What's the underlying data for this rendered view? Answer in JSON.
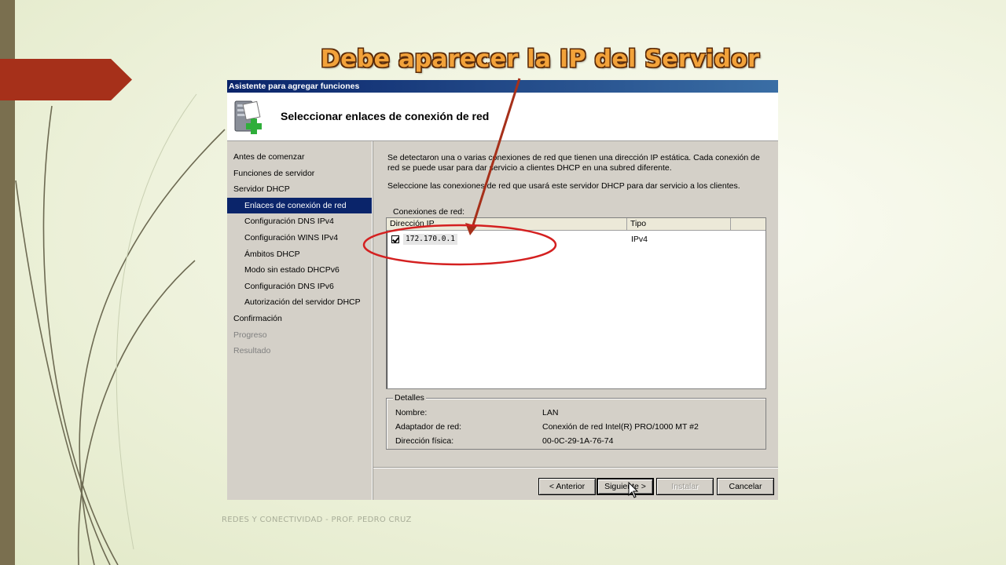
{
  "slide": {
    "title": "Debe aparecer la IP del Servidor",
    "footer": "REDES Y CONECTIVIDAD - PROF. PEDRO CRUZ"
  },
  "dialog": {
    "window_title": "Asistente para agregar funciones",
    "heading": "Seleccionar enlaces de conexión de red",
    "nav_items": [
      {
        "label": "Antes de comenzar",
        "state": "normal"
      },
      {
        "label": "Funciones de servidor",
        "state": "normal"
      },
      {
        "label": "Servidor DHCP",
        "state": "normal"
      },
      {
        "label": "Enlaces de conexión de red",
        "state": "selected"
      },
      {
        "label": "Configuración DNS IPv4",
        "state": "normal"
      },
      {
        "label": "Configuración WINS IPv4",
        "state": "normal"
      },
      {
        "label": "Ámbitos DHCP",
        "state": "normal"
      },
      {
        "label": "Modo sin estado DHCPv6",
        "state": "normal"
      },
      {
        "label": "Configuración DNS IPv6",
        "state": "normal"
      },
      {
        "label": "Autorización del servidor DHCP",
        "state": "normal"
      },
      {
        "label": "Confirmación",
        "state": "normal"
      },
      {
        "label": "Progreso",
        "state": "disabled"
      },
      {
        "label": "Resultado",
        "state": "disabled"
      }
    ],
    "description": "Se detectaron una o varias conexiones de red que tienen una dirección IP estática. Cada conexión de red se puede usar para dar servicio a clientes DHCP en una subred diferente.",
    "instruction": "Seleccione las conexiones de red que usará este servidor DHCP para dar servicio a los clientes.",
    "connections_label": "Conexiones de red:",
    "columns": [
      "Dirección IP",
      "Tipo"
    ],
    "rows": [
      {
        "checked": true,
        "ip": "172.170.0.1",
        "type": "IPv4"
      }
    ],
    "details": {
      "legend": "Detalles",
      "name_label": "Nombre:",
      "name_value": "LAN",
      "adapter_label": "Adaptador de red:",
      "adapter_value": "Conexión de red Intel(R) PRO/1000 MT #2",
      "mac_label": "Dirección física:",
      "mac_value": "00-0C-29-1A-76-74"
    },
    "buttons": {
      "back": "< Anterior",
      "next": "Siguiente >",
      "install": "Instalar",
      "cancel": "Cancelar"
    }
  },
  "colors": {
    "title_text": "#f2a23a",
    "accent_red": "#a6301a",
    "annotation": "#d42020",
    "selection": "#0a246a"
  }
}
